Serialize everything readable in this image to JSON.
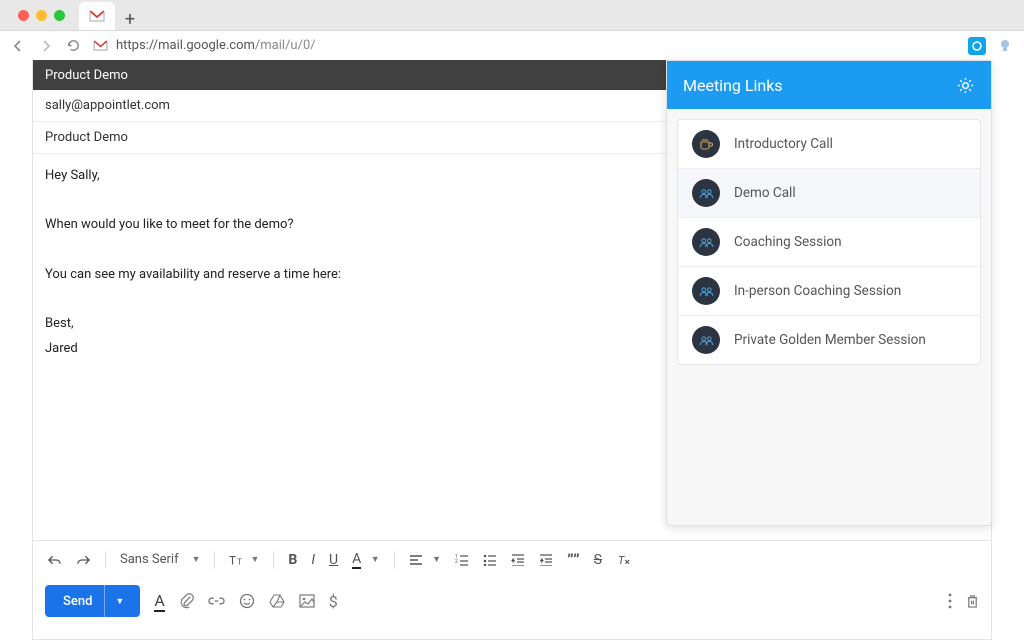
{
  "browser": {
    "url_scheme": "https://",
    "url_host": "mail.google.com",
    "url_path": "/mail/u/0/"
  },
  "compose": {
    "title": "Product Demo",
    "to": "sally@appointlet.com",
    "subject": "Product Demo",
    "body": "Hey Sally,\n\nWhen would you like to meet for the demo?\n\nYou can see my availability and reserve a time here:\n\nBest,\nJared"
  },
  "format": {
    "font": "Sans Serif"
  },
  "send": {
    "label": "Send"
  },
  "panel": {
    "title": "Meeting Links",
    "items": [
      {
        "label": "Introductory Call"
      },
      {
        "label": "Demo Call"
      },
      {
        "label": "Coaching Session"
      },
      {
        "label": "In-person Coaching Session"
      },
      {
        "label": "Private Golden Member Session"
      }
    ],
    "selected_index": 1
  }
}
